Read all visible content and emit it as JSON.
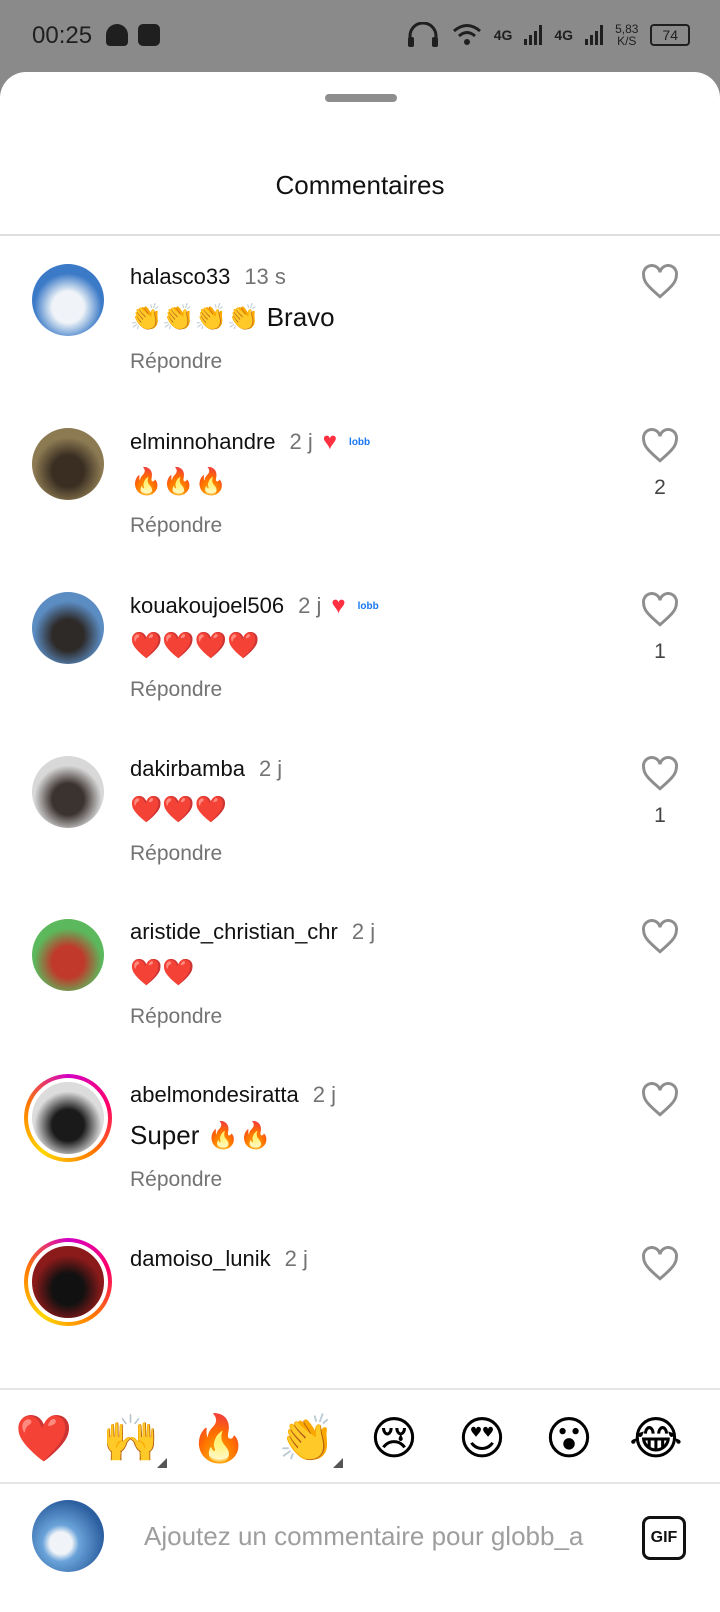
{
  "status_bar": {
    "time": "00:25",
    "network_1": "4G",
    "network_2": "4G",
    "speed_value": "5,83",
    "speed_unit": "K/S",
    "battery": "74"
  },
  "sheet": {
    "title": "Commentaires"
  },
  "comments": [
    {
      "username": "halasco33",
      "time": "13 s",
      "text": "👏👏👏👏 Bravo",
      "reply": "Répondre",
      "likes": "",
      "liked_by_author": false,
      "avatar_colors": [
        "#3b7ac7",
        "#f0f4f8"
      ]
    },
    {
      "username": "elminnohandre",
      "time": "2 j",
      "text": "🔥🔥🔥",
      "reply": "Répondre",
      "likes": "2",
      "liked_by_author": true,
      "avatar_colors": [
        "#8c7a52",
        "#3a2e22"
      ]
    },
    {
      "username": "kouakoujoel506",
      "time": "2 j",
      "text": "❤️❤️❤️❤️",
      "reply": "Répondre",
      "likes": "1",
      "liked_by_author": true,
      "avatar_colors": [
        "#5b8cc2",
        "#2e2a28"
      ]
    },
    {
      "username": "dakirbamba",
      "time": "2 j",
      "text": "❤️❤️❤️",
      "reply": "Répondre",
      "likes": "1",
      "liked_by_author": false,
      "avatar_colors": [
        "#d8d8d8",
        "#3b3330"
      ]
    },
    {
      "username": "aristide_christian_chr",
      "time": "2 j",
      "text": "❤️❤️",
      "reply": "Répondre",
      "likes": "",
      "liked_by_author": false,
      "avatar_colors": [
        "#5cb85c",
        "#c0392b"
      ]
    },
    {
      "username": "abelmondesiratta",
      "time": "2 j",
      "text": "Super 🔥🔥",
      "reply": "Répondre",
      "likes": "",
      "liked_by_author": false,
      "story_ring": true,
      "avatar_colors": [
        "#dcdcdc",
        "#1a1a1a"
      ]
    },
    {
      "username": "damoiso_lunik",
      "time": "2 j",
      "text": "",
      "reply": "",
      "likes": "",
      "liked_by_author": false,
      "story_ring": true,
      "avatar_colors": [
        "#8b1a1a",
        "#111111"
      ]
    }
  ],
  "badge_text": "lobb",
  "reactions": [
    "❤️",
    "🙌",
    "🔥",
    "👏",
    "😢",
    "😍",
    "😮",
    "😂"
  ],
  "composer": {
    "placeholder": "Ajoutez un commentaire pour globb_a",
    "gif_label": "GIF"
  }
}
